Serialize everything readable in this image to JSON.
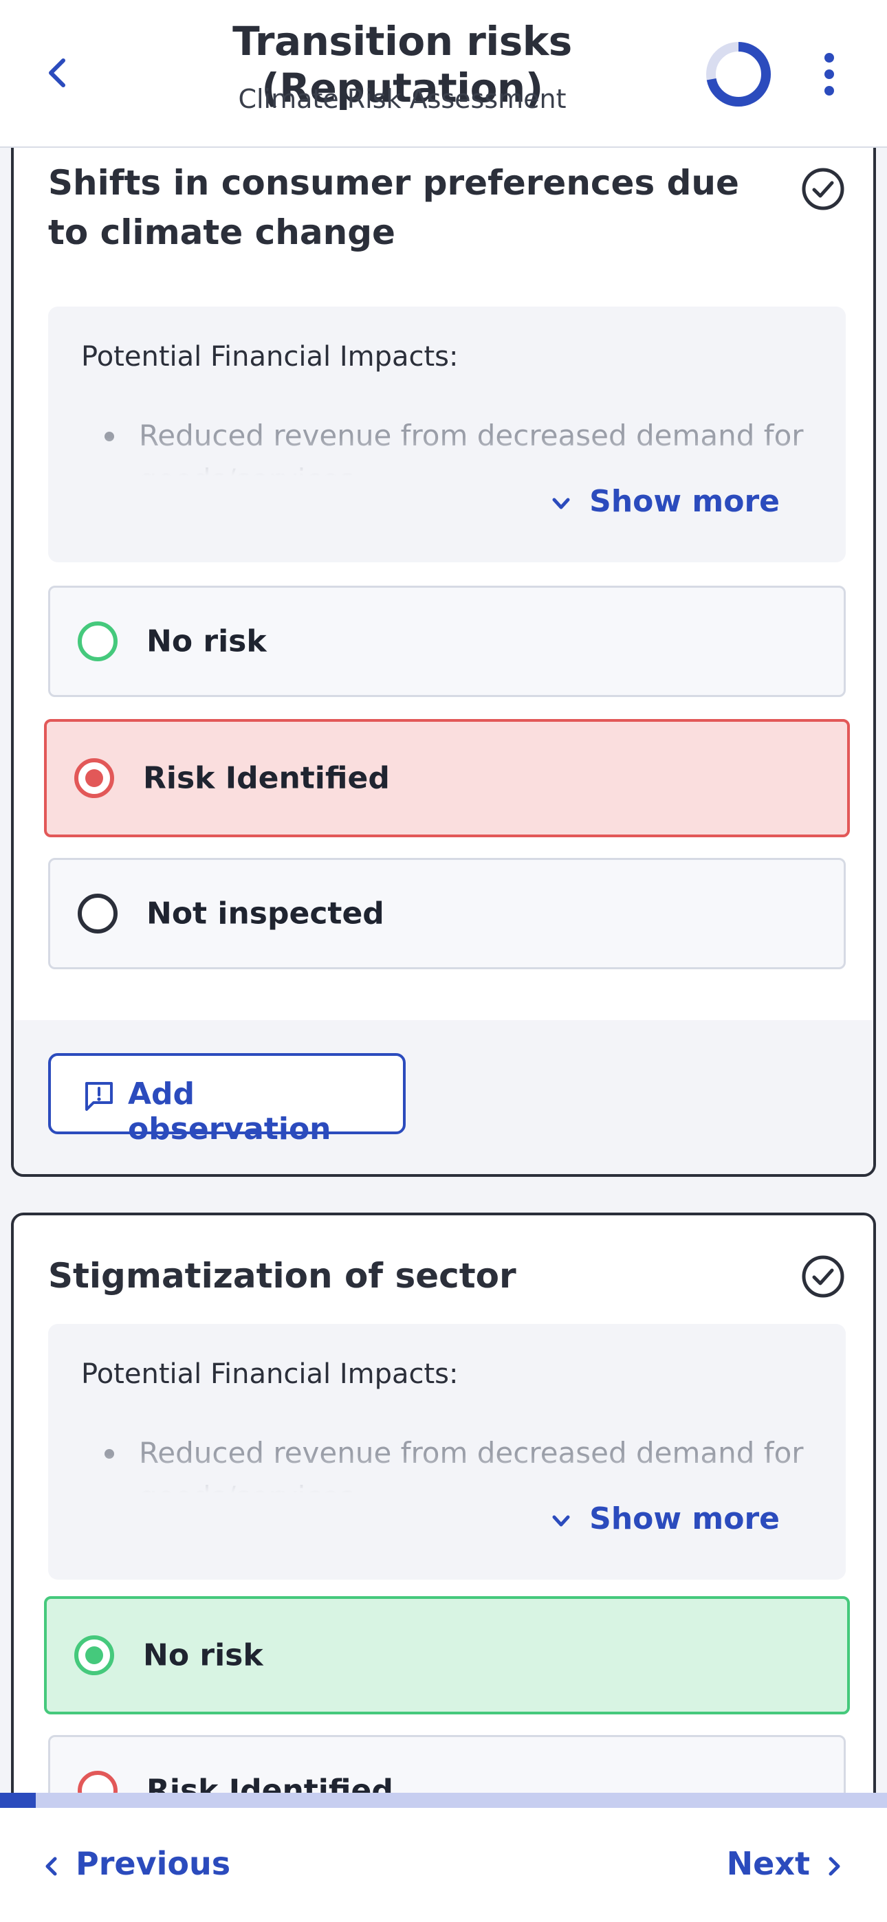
{
  "header": {
    "title": "Transition risks (Reputation)",
    "subtitle": "Climate Risk Assessment",
    "progress_fraction": 0.72,
    "icons": {
      "back": "chevron-left-icon",
      "menu": "more-vertical-icon"
    }
  },
  "cards": [
    {
      "title": "Shifts in consumer preferences due to climate change",
      "status_icon": "check-circle-icon",
      "impacts_label": "Potential Financial Impacts:",
      "impact_text": "Reduced revenue from decreased demand for goods/services",
      "show_more": "Show more",
      "options": [
        {
          "label": "No risk",
          "state": "unselected",
          "color": "#45c97c"
        },
        {
          "label": "Risk Identified",
          "state": "selected",
          "color": "#e25858"
        },
        {
          "label": "Not inspected",
          "state": "unselected",
          "color": "#2b2f3a"
        }
      ],
      "add_observation": "Add observation"
    },
    {
      "title": "Stigmatization of sector",
      "status_icon": "check-circle-icon",
      "impacts_label": "Potential Financial Impacts:",
      "impact_text": "Reduced revenue from decreased demand for goods/services",
      "show_more": "Show more",
      "options": [
        {
          "label": "No risk",
          "state": "selected",
          "color": "#45c97c"
        },
        {
          "label": "Risk Identified",
          "state": "unselected",
          "color": "#e25858"
        }
      ]
    }
  ],
  "footer": {
    "progress_fraction": 0.04,
    "previous": "Previous",
    "next": "Next"
  },
  "colors": {
    "accent": "#2b4bbd",
    "risk_red": "#e25858",
    "no_risk_green": "#45c97c",
    "background": "#f3f4f8"
  }
}
